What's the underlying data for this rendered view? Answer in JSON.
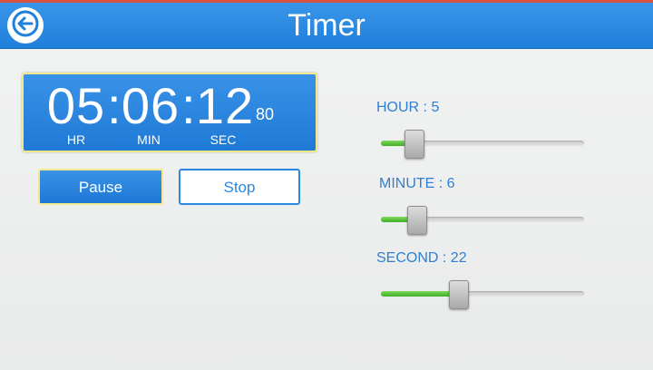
{
  "header": {
    "title": "Timer",
    "back_icon": "back-arrow-icon"
  },
  "clock": {
    "hours": "05",
    "minutes": "06",
    "seconds": "12",
    "centiseconds": "80",
    "separator": ":",
    "labels": {
      "hr": "HR",
      "min": "MIN",
      "sec": "SEC"
    }
  },
  "buttons": {
    "pause_label": "Pause",
    "stop_label": "Stop"
  },
  "sliders": [
    {
      "label": "HOUR : 5",
      "value": 5,
      "max": 100
    },
    {
      "label": "MINUTE : 6",
      "value": 6,
      "max": 100
    },
    {
      "label": "SECOND : 22",
      "value": 22,
      "max": 100
    }
  ],
  "colors": {
    "accent": "#2a88e2",
    "header": "#1f7fdb",
    "slider_fill": "#3fae27"
  }
}
